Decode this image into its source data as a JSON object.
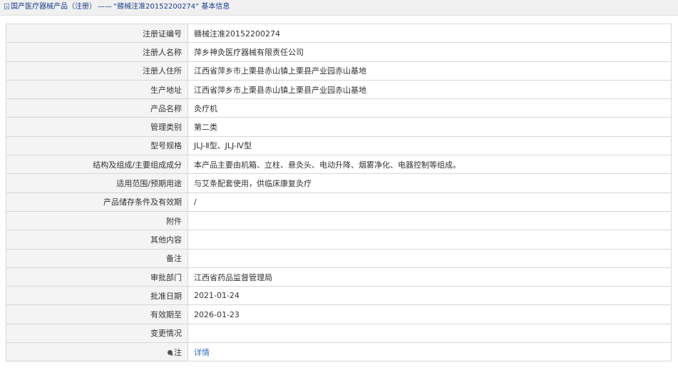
{
  "breadcrumb": {
    "section": "国产医疗器械产品（注册）",
    "separator": "——",
    "title": "“赣械注准20152200274”",
    "suffix": "基本信息"
  },
  "rows": [
    {
      "label": "注册证编号",
      "value": "赣械注准20152200274"
    },
    {
      "label": "注册人名称",
      "value": "萍乡神灸医疗器械有限责任公司"
    },
    {
      "label": "注册人住所",
      "value": "江西省萍乡市上栗县赤山镇上栗县产业园赤山基地"
    },
    {
      "label": "生产地址",
      "value": "江西省萍乡市上栗县赤山镇上栗县产业园赤山基地"
    },
    {
      "label": "产品名称",
      "value": "灸疗机"
    },
    {
      "label": "管理类别",
      "value": "第二类"
    },
    {
      "label": "型号规格",
      "value": "JLJ-Ⅱ型、JLJ-Ⅳ型"
    },
    {
      "label": "结构及组成/主要组成成分",
      "value": "本产品主要由机箱、立柱、悬灸头、电动升降、烟雾净化、电器控制等组成。"
    },
    {
      "label": "适用范围/预期用途",
      "value": "与艾条配套使用，供临床康复灸疗"
    },
    {
      "label": "产品储存条件及有效期",
      "value": "/"
    },
    {
      "label": "附件",
      "value": ""
    },
    {
      "label": "其他内容",
      "value": ""
    },
    {
      "label": "备注",
      "value": ""
    },
    {
      "label": "审批部门",
      "value": "江西省药品监督管理局"
    },
    {
      "label": "批准日期",
      "value": "2021-01-24"
    },
    {
      "label": "有效期至",
      "value": "2026-01-23"
    },
    {
      "label": "变更情况",
      "value": ""
    }
  ],
  "note_row": {
    "label": "注",
    "link_text": "详情"
  }
}
